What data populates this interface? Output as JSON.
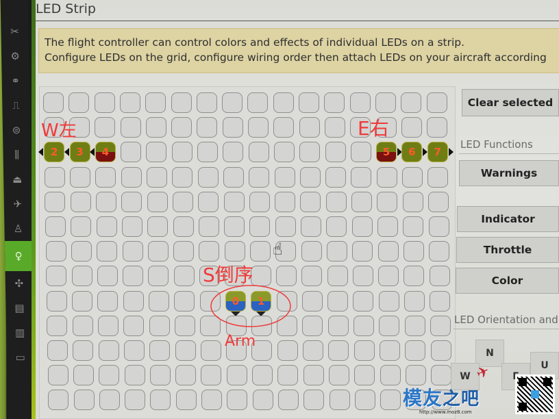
{
  "sidebar": {
    "items": [
      {
        "icon": "✂",
        "name": "setup-icon",
        "active": false
      },
      {
        "icon": "⚙",
        "name": "gear-icon",
        "active": false
      },
      {
        "icon": "⚭",
        "name": "ports-icon",
        "active": false
      },
      {
        "icon": "⎍",
        "name": "receiver-icon",
        "active": false
      },
      {
        "icon": "⊜",
        "name": "modes-icon",
        "active": false
      },
      {
        "icon": "⫼",
        "name": "adjustments-icon",
        "active": false
      },
      {
        "icon": "⏏",
        "name": "servos-icon",
        "active": false
      },
      {
        "icon": "✈",
        "name": "gps-icon",
        "active": false
      },
      {
        "icon": "♙",
        "name": "motors-icon",
        "active": false
      },
      {
        "icon": "♀",
        "name": "led-strip-icon",
        "active": true
      },
      {
        "icon": "✣",
        "name": "sensors-icon",
        "active": false
      },
      {
        "icon": "▤",
        "name": "logging-icon",
        "active": false
      },
      {
        "icon": "▥",
        "name": "blackbox-icon",
        "active": false
      },
      {
        "icon": "▭",
        "name": "cli-icon",
        "active": false
      }
    ]
  },
  "header": {
    "title": "LED Strip"
  },
  "note": {
    "line1": "The flight controller can control colors and effects of individual LEDs on a strip.",
    "line2": "Configure LEDs on the grid, configure wiring order then attach LEDs on your aircraft according"
  },
  "grid": {
    "columns": 16,
    "rows": 13,
    "leds": [
      {
        "index": "0",
        "row": 8,
        "col": 7,
        "top_color": "#8a9a2a",
        "bottom_color": "#2a62c2",
        "direction": "S"
      },
      {
        "index": "1",
        "row": 8,
        "col": 8,
        "top_color": "#8a9a2a",
        "bottom_color": "#2a62c2",
        "direction": "S"
      },
      {
        "index": "2",
        "row": 2,
        "col": 0,
        "top_color": "#6f7e14",
        "bottom_color": "#6f7e14",
        "direction": "W"
      },
      {
        "index": "3",
        "row": 2,
        "col": 1,
        "top_color": "#6f7e14",
        "bottom_color": "#6f7e14",
        "direction": "W"
      },
      {
        "index": "4",
        "row": 2,
        "col": 2,
        "top_color": "#6f7e14",
        "bottom_color": "#7a1010",
        "direction": "W"
      },
      {
        "index": "5",
        "row": 2,
        "col": 13,
        "top_color": "#6f7e14",
        "bottom_color": "#7a1010",
        "direction": "E"
      },
      {
        "index": "6",
        "row": 2,
        "col": 14,
        "top_color": "#6f7e14",
        "bottom_color": "#6f7e14",
        "direction": "E"
      },
      {
        "index": "7",
        "row": 2,
        "col": 15,
        "top_color": "#6f7e14",
        "bottom_color": "#6f7e14",
        "direction": "E"
      }
    ]
  },
  "controls": {
    "clear_selected": "Clear selected",
    "led_functions_label": "LED Functions",
    "functions": [
      "Warnings",
      "Indicator",
      "Throttle",
      "Color"
    ],
    "orientation_label": "LED Orientation and",
    "directions": {
      "n": "N",
      "w": "W",
      "e": "E",
      "u": "U"
    }
  },
  "annotations": {
    "west": "W左",
    "east": "E右",
    "south": "S倒序",
    "arm": "Arm"
  },
  "watermark": {
    "text_main": "模友",
    "text_sub": "之吧",
    "url": "http://www.moz8.com"
  }
}
